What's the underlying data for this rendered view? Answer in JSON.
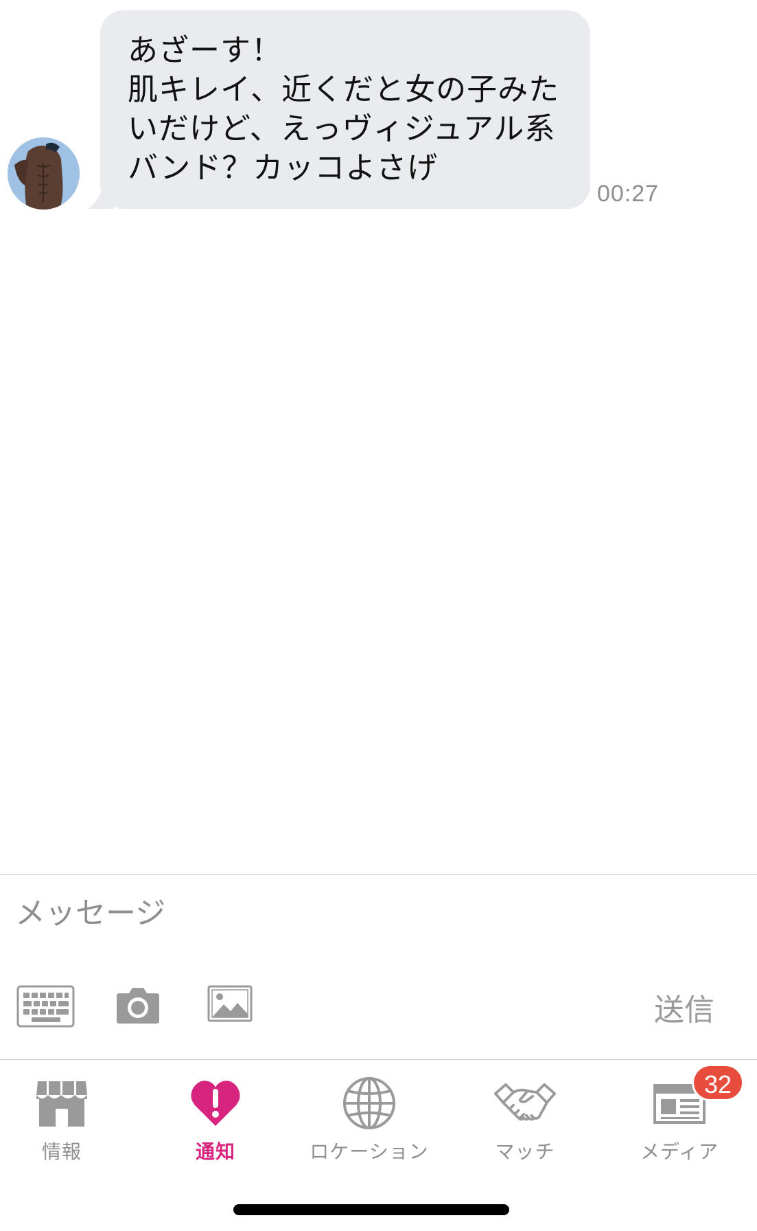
{
  "chat": {
    "messages": [
      {
        "sender": "other",
        "avatar_icon": "user-avatar-photo",
        "text": "あざーす！\n肌キレイ、近くだと女の子みた\nいだけど、えっヴィジュアル系\nバンド？カッコよさげ",
        "time": "00:27",
        "bubble_color": "#e9ebee"
      }
    ]
  },
  "composer": {
    "placeholder": "メッセージ",
    "value": "",
    "tools": [
      {
        "icon": "keyboard-icon"
      },
      {
        "icon": "camera-icon"
      },
      {
        "icon": "image-icon"
      }
    ],
    "send_label": "送信"
  },
  "tab_bar": {
    "tabs": [
      {
        "label": "情報",
        "icon": "store-icon",
        "active": false
      },
      {
        "label": "通知",
        "icon": "heart-alert-icon",
        "active": true
      },
      {
        "label": "ロケーション",
        "icon": "globe-icon",
        "active": false
      },
      {
        "label": "マッチ",
        "icon": "handshake-icon",
        "active": false
      },
      {
        "label": "メディア",
        "icon": "newspaper-icon",
        "active": false,
        "badge": "32"
      }
    ],
    "active_color": "#d6247f",
    "inactive_color": "#8e8e93",
    "badge_color": "#e74c3c"
  }
}
